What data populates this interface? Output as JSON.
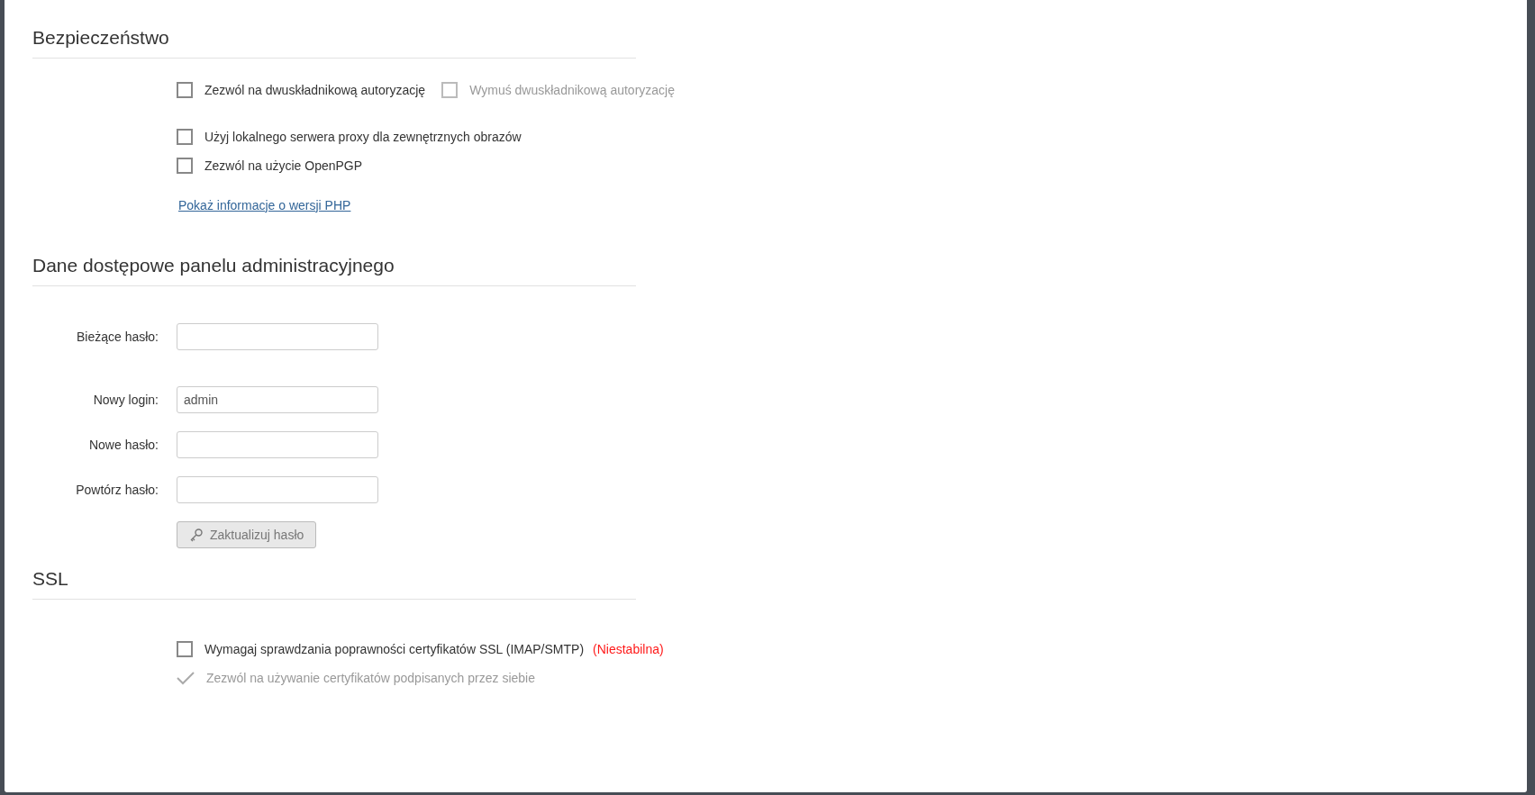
{
  "sections": [
    {
      "title": "Bezpieczeństwo",
      "groups": [
        [
          {
            "kind": "checks",
            "checks": [
              {
                "label": "Zezwól na dwuskładnikową autoryzację",
                "checked": false,
                "disabled": false
              },
              {
                "label": "Wymuś dwuskładnikową autoryzację",
                "checked": false,
                "disabled": true
              }
            ]
          }
        ],
        [
          {
            "kind": "checks",
            "checks": [
              {
                "label": "Użyj lokalnego serwera proxy dla zewnętrznych obrazów",
                "checked": false,
                "disabled": false
              }
            ]
          },
          {
            "kind": "checks",
            "checks": [
              {
                "label": "Zezwól na użycie OpenPGP",
                "checked": false,
                "disabled": false
              }
            ]
          }
        ],
        [
          {
            "kind": "link",
            "label": "Pokaż informacje o wersji PHP"
          }
        ]
      ]
    },
    {
      "title": "Dane dostępowe panelu administracyjnego",
      "groups": [
        [
          {
            "kind": "field",
            "label": "Bieżące hasło:"
          }
        ],
        [
          {
            "kind": "field",
            "label": "Nowy login:",
            "value": "admin"
          },
          {
            "kind": "field",
            "label": "Nowe hasło:"
          },
          {
            "kind": "field",
            "label": "Powtórz hasło:"
          },
          {
            "kind": "button",
            "label": "Zaktualizuj hasło",
            "disabled": true
          }
        ]
      ]
    },
    {
      "title": "SSL",
      "groups": [
        [
          {
            "kind": "checks",
            "checks": [
              {
                "label": "Wymagaj sprawdzania poprawności certyfikatów SSL (IMAP/SMTP)",
                "checked": false,
                "disabled": false,
                "note": "(Niestabilna)"
              }
            ]
          },
          {
            "kind": "checks",
            "checks": [
              {
                "label": "Zezwól na używanie certyfikatów podpisanych przez siebie",
                "checked": true,
                "disabled": true
              }
            ]
          }
        ]
      ]
    }
  ]
}
